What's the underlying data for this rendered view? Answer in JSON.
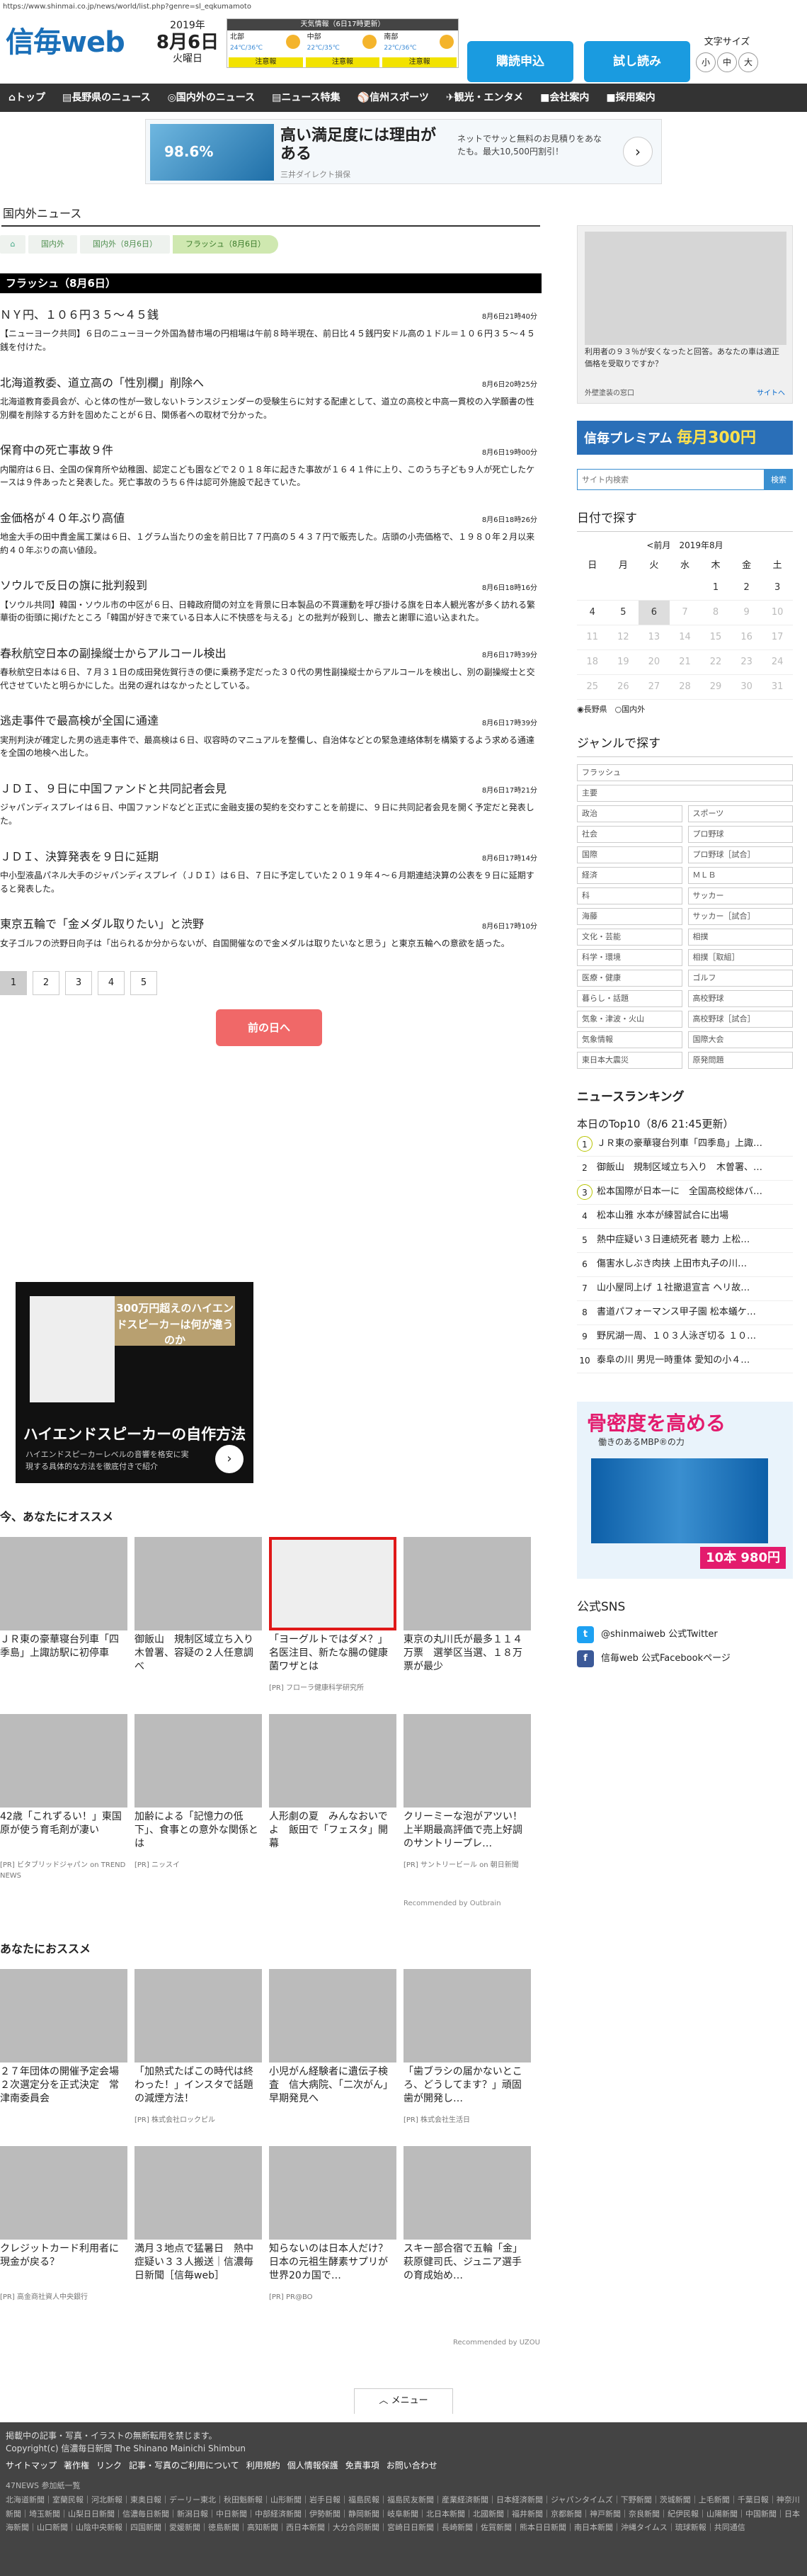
{
  "url": "https://www.shinmai.co.jp/news/world/list.php?genre=sl_eqkumamoto",
  "header": {
    "logo": "信毎web",
    "year": "2019年",
    "md": "8月6日",
    "weekday": "火曜日",
    "weather_title": "天気情報（6日17時更新）",
    "weather": [
      {
        "area": "北部",
        "temp": "24℃/36℃"
      },
      {
        "area": "中部",
        "temp": "22℃/35℃"
      },
      {
        "area": "南部",
        "temp": "22℃/36℃"
      }
    ],
    "warnings": [
      "注意報",
      "注意報",
      "注意報"
    ],
    "btn1": "購読申込",
    "btn2": "試し読み",
    "fontsize": "文字サイズ",
    "fs": [
      "小",
      "中",
      "大"
    ]
  },
  "nav": [
    "トップ",
    "長野県のニュース",
    "国内外のニュース",
    "ニュース特集",
    "信州スポーツ",
    "観光・エンタメ",
    "会社案内",
    "採用案内"
  ],
  "adtop": {
    "img": "98.6%",
    "t1": "高い満足度には理由がある",
    "t2": "三井ダイレクト損保",
    "t3": "ネットでサッと無料のお見積りをあなたも。最大10,500円割引！"
  },
  "main": {
    "title": "国内外ニュース",
    "crumbs": [
      "国内外",
      "国内外（8月6日）",
      "フラッシュ（8月6日）"
    ],
    "bar": "フラッシュ（8月6日）",
    "news": [
      {
        "h": "ＮＹ円、１０６円３５～４５銭",
        "t": "8月6日21時40分",
        "p": "【ニューヨーク共同】６日のニューヨーク外国為替市場の円相場は午前８時半現在、前日比４５銭円安ドル高の１ドル＝１０６円３５～４５銭を付けた。"
      },
      {
        "h": "北海道教委、道立高の「性別欄」削除へ",
        "t": "8月6日20時25分",
        "p": "北海道教育委員会が、心と体の性が一致しないトランスジェンダーの受験生らに対する配慮として、道立の高校と中高一貫校の入学願書の性別欄を削除する方針を固めたことが６日、関係者への取材で分かった。"
      },
      {
        "h": "保育中の死亡事故９件",
        "t": "8月6日19時00分",
        "p": "内閣府は６日、全国の保育所や幼稚園、認定こども園などで２０１８年に起きた事故が１６４１件に上り、このうち子ども９人が死亡したケースは９件あったと発表した。死亡事故のうち６件は認可外施設で起きていた。"
      },
      {
        "h": "金価格が４０年ぶり高値",
        "t": "8月6日18時26分",
        "p": "地金大手の田中貴金属工業は６日、１グラム当たりの金を前日比７７円高の５４３７円で販売した。店頭の小売価格で、１９８０年２月以来約４０年ぶりの高い値段。"
      },
      {
        "h": "ソウルで反日の旗に批判殺到",
        "t": "8月6日18時16分",
        "p": "【ソウル共同】韓国・ソウル市の中区が６日、日韓政府間の対立を背景に日本製品の不買運動を呼び掛ける旗を日本人観光客が多く訪れる繁華街の街頭に掲げたところ「韓国が好きで来ている日本人に不快感を与える」との批判が殺到し、撤去と謝罪に追い込まれた。"
      },
      {
        "h": "春秋航空日本の副操縦士からアルコール検出",
        "t": "8月6日17時39分",
        "p": "春秋航空日本は６日、７月３１日の成田発佐賀行きの便に乗務予定だった３０代の男性副操縦士からアルコールを検出し、別の副操縦士と交代させていたと明らかにした。出発の遅れはなかったとしている。"
      },
      {
        "h": "逃走事件で最高検が全国に通達",
        "t": "8月6日17時39分",
        "p": "実刑判決が確定した男の逃走事件で、最高検は６日、収容時のマニュアルを整備し、自治体などとの緊急連絡体制を構築するよう求める通達を全国の地検へ出した。"
      },
      {
        "h": "ＪＤＩ、９日に中国ファンドと共同記者会見",
        "t": "8月6日17時21分",
        "p": "ジャパンディスプレイは６日、中国ファンドなどと正式に金融支援の契約を交わすことを前提に、９日に共同記者会見を開く予定だと発表した。"
      },
      {
        "h": "ＪＤＩ、決算発表を９日に延期",
        "t": "8月6日17時14分",
        "p": "中小型液晶パネル大手のジャパンディスプレイ（ＪＤＩ）は６日、７日に予定していた２０１９年４～６月期連結決算の公表を９日に延期すると発表した。"
      },
      {
        "h": "東京五輪で「金メダル取りたい」と渋野",
        "t": "8月6日17時10分",
        "p": "女子ゴルフの渋野日向子は「出られるか分からないが、自国開催なので金メダルは取りたいなと思う」と東京五輪への意欲を語った。"
      }
    ],
    "pages": [
      "1",
      "2",
      "3",
      "4",
      "5"
    ],
    "prev": "前の日へ"
  },
  "ad2": {
    "b2": "300万円超えのハイエンドスピーカーは何が違うのか",
    "t": "ハイエンドスピーカーの自作方法",
    "s": "ハイエンドスピーカーレベルの音響を格安に実現する具体的な方法を徹底付きで紹介"
  },
  "rec1": {
    "title": "今、あなたにオススメ",
    "cards": [
      {
        "c": "ＪＲ東の豪華寝台列車「四季島」上諏訪駅に初停車",
        "p": ""
      },
      {
        "c": "御飯山　規制区域立ち入り　木曽署、容疑の２人任意調べ",
        "p": ""
      },
      {
        "c": "「ヨーグルトではダメ？」名医注目、新たな腸の健康菌ワザとは",
        "p": "[PR] フローラ健康科学研究所"
      },
      {
        "c": "東京の丸川氏が最多１１４万票　選挙区当選、１８万票が最少",
        "p": ""
      },
      {
        "c": "42歳「これずるい！」東国原が使う育毛剤が凄い",
        "p": "[PR] ビタブリッドジャパン on TREND NEWS"
      },
      {
        "c": "加齢による「記憶力の低下」、食事との意外な関係とは",
        "p": "[PR] ニッスイ"
      },
      {
        "c": "人形劇の夏　みんなおいでよ　飯田で「フェスタ」開幕",
        "p": ""
      },
      {
        "c": "クリーミーな泡がアツい！上半期最高評価で売上好調のサントリープレ…",
        "p": "[PR] サントリービール on 朝日新聞"
      }
    ],
    "credit": "Recommended by Outbrain"
  },
  "rec2": {
    "title": "あなたにおススメ",
    "cards": [
      {
        "c": "２７年団体の開催予定会場　２次選定分を正式決定　常津南委員会",
        "p": ""
      },
      {
        "c": "「加熱式たばこの時代は終わった！」インスタで話題の減煙方法！",
        "p": "[PR] 株式会社ロックピル"
      },
      {
        "c": "小児がん経験者に遺伝子検査　信大病院、「二次がん」早期発見へ",
        "p": ""
      },
      {
        "c": "「歯ブラシの届かないところ、どうしてます？」頑固歯が開発し…",
        "p": "[PR] 株式会社生活日"
      },
      {
        "c": "クレジットカード利用者に現金が戻る？",
        "p": "[PR] 高金商社資人中央銀行"
      },
      {
        "c": "満月３地点で猛暑日　熱中症疑い３３人搬送｜信濃毎日新聞［信毎web］",
        "p": ""
      },
      {
        "c": "知らないのは日本人だけ？日本の元祖生酵素サプリが世界20カ国で…",
        "p": "[PR] PR@BO"
      },
      {
        "c": "スキー部合宿で五輪「金」　萩原健司氏、ジュニア選手の育成始め…",
        "p": ""
      }
    ],
    "credit": "Recommended by UZOU"
  },
  "side": {
    "adtxt": "利用者の９３％が安くなったと回答。あなたの車は適正価格を受取りですか？",
    "adft": "外壁塗装の窓口",
    "adlink": "サイトへ",
    "pr": "信毎プレミアム",
    "pr300": "毎月300円",
    "search_ph": "サイト内検索",
    "search_btn": "検索",
    "cal_title": "日付で探す",
    "cal_prev": "<前月",
    "cal_month": "2019年8月",
    "wd": [
      "日",
      "月",
      "火",
      "水",
      "木",
      "金",
      "土"
    ],
    "weeks": [
      [
        "",
        "",
        "",
        "",
        "1",
        "2",
        "3"
      ],
      [
        "4",
        "5",
        "6",
        "7",
        "8",
        "9",
        "10"
      ],
      [
        "11",
        "12",
        "13",
        "14",
        "15",
        "16",
        "17"
      ],
      [
        "18",
        "19",
        "20",
        "21",
        "22",
        "23",
        "24"
      ],
      [
        "25",
        "26",
        "27",
        "28",
        "29",
        "30",
        "31"
      ]
    ],
    "radio": [
      "長野県",
      "国内外"
    ],
    "genre_title": "ジャンルで探す",
    "genres": [
      "フラッシュ",
      "主要",
      "政治",
      "スポーツ",
      "社会",
      "プロ野球",
      "国際",
      "プロ野球［試合］",
      "経済",
      "ＭＬＢ",
      "科",
      "サッカー",
      "海藤",
      "サッカー［試合］",
      "文化・芸能",
      "相撲",
      "科学・環境",
      "相撲［取組］",
      "医療・健康",
      "ゴルフ",
      "暮らし・話題",
      "高校野球",
      "気象・津波・火山",
      "高校野球［試合］",
      "気象情報",
      "国際大会",
      "東日本大震災",
      "原発問題"
    ],
    "rank_title": "ニュースランキング",
    "rank_sub": "本日のTop10（8/6 21:45更新）",
    "ranks": [
      "ＪＲ東の豪華寝台列車「四季島」上諏…",
      "御飯山　規制区域立ち入り　木曽署、…",
      "松本国際が日本一に　全国高校総体バ…",
      "松本山雅 水本が練習試合に出場",
      "熱中症疑い３日連続死者 聴力 上松…",
      "傷害水しぶき肉挟 上田市丸子の川…",
      "山小屋同上げ １社撤退宣言 ヘリ故…",
      "書道パフォーマンス甲子園 松本蟻ケ…",
      "野尻湖一周、１０３人泳ぎ切る １０…",
      "泰阜の川 男児一時重体 愛知の小４…"
    ],
    "mbp_t": "骨密度を高める",
    "mbp_s": "働きのあるMBP®の力",
    "mbp_p": "10本 980円",
    "sns_title": "公式SNS",
    "tw": "@shinmaiweb 公式Twitter",
    "fb": "信毎web 公式Facebookページ"
  },
  "footer": {
    "menu": "メニュー",
    "notice": "掲載中の記事・写真・イラストの無断転用を禁じます。",
    "copy": "Copyright(c) 信濃毎日新聞 The Shinano Mainichi Shimbun",
    "links": [
      "サイトマップ",
      "著作権",
      "リンク",
      "記事・写真のご利用について",
      "利用規約",
      "個人情報保護",
      "免責事項",
      "お問い合わせ"
    ],
    "np_title": "47NEWS 参加紙一覧",
    "np": "北海道新聞｜室蘭民報｜河北新報｜東奥日報｜デーリー東北｜秋田魁新報｜山形新聞｜岩手日報｜福島民報｜福島民友新聞｜産業経済新聞｜日本経済新聞｜ジャパンタイムズ｜下野新聞｜茨城新聞｜上毛新聞｜千葉日報｜神奈川新聞｜埼玉新聞｜山梨日日新聞｜信濃毎日新聞｜新潟日報｜中日新聞｜中部経済新聞｜伊勢新聞｜静岡新聞｜岐阜新聞｜北日本新聞｜北國新聞｜福井新聞｜京都新聞｜神戸新聞｜奈良新聞｜紀伊民報｜山陽新聞｜中国新聞｜日本海新聞｜山口新聞｜山陰中央新報｜四国新聞｜愛媛新聞｜徳島新聞｜高知新聞｜西日本新聞｜大分合同新聞｜宮崎日日新聞｜長崎新聞｜佐賀新聞｜熊本日日新聞｜南日本新聞｜沖縄タイムス｜琉球新報｜共同通信"
  }
}
